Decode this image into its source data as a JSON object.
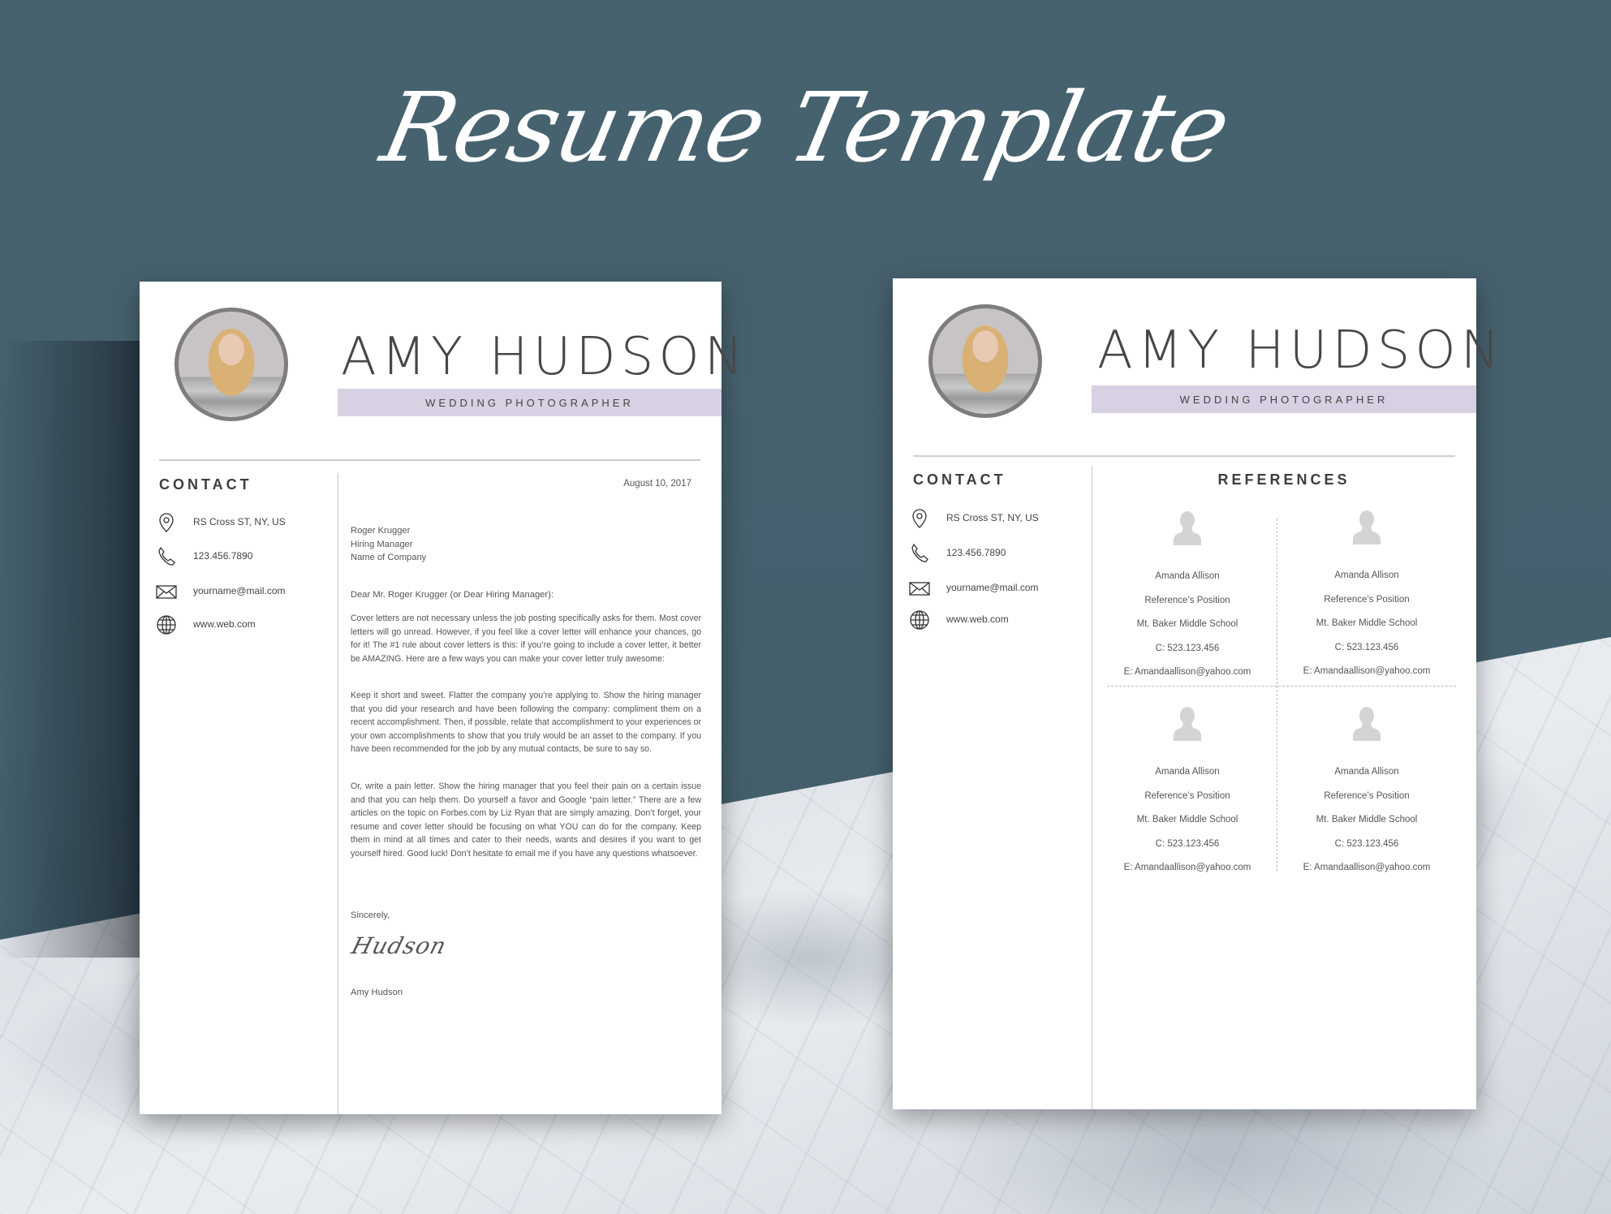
{
  "hero_title": "Resume Template",
  "colors": {
    "background": "#47626f",
    "banner": "#d8d0e3",
    "text_dark": "#474747",
    "avatar_placeholder": "#d4d4d4"
  },
  "cover_letter_page": {
    "name": "AMY HUDSON",
    "job_title": "WEDDING PHOTOGRAPHER",
    "contact_heading": "CONTACT",
    "contact": [
      {
        "icon": "location-pin-icon",
        "text": "RS Cross ST, NY, US"
      },
      {
        "icon": "phone-icon",
        "text": "123.456.7890"
      },
      {
        "icon": "envelope-icon",
        "text": "yourname@mail.com"
      },
      {
        "icon": "globe-icon",
        "text": "www.web.com"
      }
    ],
    "date": "August 10, 2017",
    "recipient": [
      "Roger Krugger",
      "Hiring Manager",
      "Name of Company"
    ],
    "salutation": "Dear Mr. Roger Krugger (or Dear Hiring Manager):",
    "paragraphs": [
      "Cover letters are not necessary unless the job posting specifically asks for them.  Most cover letters will go unread.  However, if you feel like a cover letter will enhance your chances, go for it!  The #1 rule about cover letters is this: if you’re going to include a cover letter, it better be AMAZING.  Here are a few ways you can make your cover letter truly awesome:",
      "Keep it short and sweet.  Flatter the company you’re applying to.  Show the hiring manager that you did your research and have been following the company: compliment them on a recent accomplishment.  Then, if possible, relate that accomplishment to your experiences or your own accomplishments to show that you truly would be an asset to the company.  If you have been recommended for the job by any mutual contacts, be sure to say so.",
      "Or, write a pain letter.  Show the hiring manager that you feel their pain on a certain issue and that you can help them.  Do yourself a favor and Google “pain letter.”  There are a few articles on the topic on Forbes.com by Liz Ryan that are simply amazing.  Don’t forget, your resume and cover letter should be focusing on what YOU can do for the company.  Keep them in mind at all times and cater to their needs, wants and desires if you want to get yourself hired.  Good luck!  Don’t hesitate to email me if you have any questions whatsoever."
    ],
    "closing": "Sincerely,",
    "signature": "Hudson",
    "signer": "Amy Hudson"
  },
  "references_page": {
    "name": "AMY HUDSON",
    "job_title": "WEDDING PHOTOGRAPHER",
    "contact_heading": "CONTACT",
    "contact": [
      {
        "icon": "location-pin-icon",
        "text": "RS Cross ST, NY, US"
      },
      {
        "icon": "phone-icon",
        "text": "123.456.7890"
      },
      {
        "icon": "envelope-icon",
        "text": "yourname@mail.com"
      },
      {
        "icon": "globe-icon",
        "text": "www.web.com"
      }
    ],
    "references_heading": "REFERENCES",
    "references": [
      {
        "name": "Amanda Allison",
        "position": "Reference’s Position",
        "organization": "Mt. Baker Middle School",
        "phone": "C: 523.123.456",
        "email": "E: Amandaallison@yahoo.com"
      },
      {
        "name": "Amanda Allison",
        "position": "Reference’s Position",
        "organization": "Mt. Baker Middle School",
        "phone": "C: 523.123.456",
        "email": "E: Amandaallison@yahoo.com"
      },
      {
        "name": "Amanda Allison",
        "position": "Reference’s Position",
        "organization": "Mt. Baker Middle School",
        "phone": "C: 523.123.456",
        "email": "E: Amandaallison@yahoo.com"
      },
      {
        "name": "Amanda Allison",
        "position": "Reference’s Position",
        "organization": "Mt. Baker Middle School",
        "phone": "C: 523.123.456",
        "email": "E: Amandaallison@yahoo.com"
      }
    ]
  }
}
